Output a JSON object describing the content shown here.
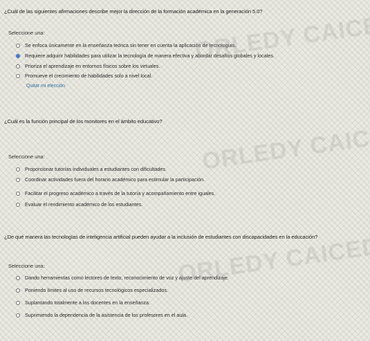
{
  "watermark": "ORLEDY CAICEDO S",
  "questions": [
    {
      "text": "¿Cuál de las siguientes afirmaciones describe mejor la dirección de la formación académica en la generación 5.0?",
      "select_label": "Seleccione una:",
      "options": [
        "Se enfoca únicamente en la enseñanza teórica sin tener en cuenta la aplicación de tecnologías.",
        "Requiere adquirir habilidades para utilizar la tecnología de manera efectiva y abordar desafíos globales y locales.",
        "Prioriza el aprendizaje en entornos físicos sobre los virtuales.",
        "Promueve el crecimiento de habilidades solo a nivel local."
      ],
      "selected_index": 1,
      "clear_label": "Quitar mi elección"
    },
    {
      "text": "¿Cuál es la función principal de los monitores en el ámbito educativo?",
      "select_label": "Seleccione una:",
      "options": [
        "Proporcionar tutorías individuales a estudiantes con dificultades.",
        "Coordinar actividades fuera del horario académico para estimular la participación.",
        "Facilitar el progreso académico a través de la tutoría y acompañamiento entre iguales.",
        "Evaluar el rendimiento académico de los estudiantes."
      ],
      "selected_index": null
    },
    {
      "text": "¿De qué manera las tecnologías de inteligencia artificial pueden ayudar a la inclusión de estudiantes con discapacidades en la educación?",
      "select_label": "Seleccione una:",
      "options": [
        "Dando herramientas como lectores de texto, reconocimiento de voz y ajuste del aprendizaje.",
        "Poniendo límites al uso de recursos tecnológicos especializados.",
        "Suplantando totalmente a los docentes en la enseñanza.",
        "Suprimiendo la dependencia de la asistencia de los profesores en el aula."
      ],
      "selected_index": null
    }
  ]
}
